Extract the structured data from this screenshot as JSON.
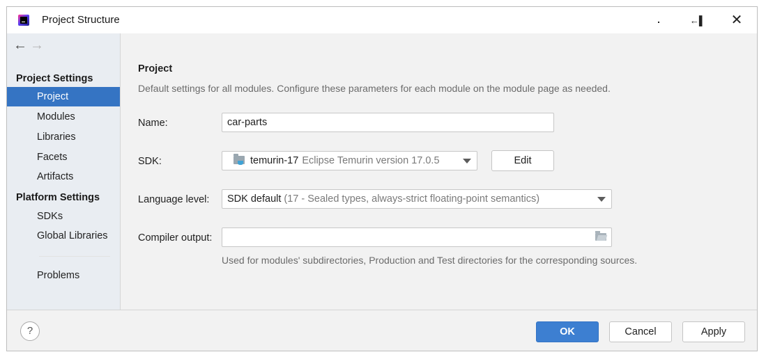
{
  "window": {
    "title": "Project Structure"
  },
  "sidebar": {
    "groups": [
      {
        "label": "Project Settings"
      },
      {
        "label": "Platform Settings"
      }
    ],
    "items": [
      {
        "label": "Project",
        "active": true
      },
      {
        "label": "Modules"
      },
      {
        "label": "Libraries"
      },
      {
        "label": "Facets"
      },
      {
        "label": "Artifacts"
      },
      {
        "label": "SDKs"
      },
      {
        "label": "Global Libraries"
      },
      {
        "label": "Problems"
      }
    ]
  },
  "main": {
    "title": "Project",
    "description": "Default settings for all modules. Configure these parameters for each module on the module page as needed.",
    "name": {
      "label": "Name:",
      "value": "car-parts"
    },
    "sdk": {
      "label": "SDK:",
      "name": "temurin-17",
      "version": "Eclipse Temurin version 17.0.5",
      "edit_label": "Edit"
    },
    "language_level": {
      "label": "Language level:",
      "value": "SDK default",
      "detail": "(17 - Sealed types, always-strict floating-point semantics)"
    },
    "compiler_output": {
      "label": "Compiler output:",
      "value": "",
      "hint": "Used for modules' subdirectories, Production and Test directories for the corresponding sources."
    }
  },
  "footer": {
    "help": "?",
    "ok": "OK",
    "cancel": "Cancel",
    "apply": "Apply"
  },
  "colors": {
    "accent": "#3574c3",
    "ok_button": "#3d7fd1",
    "sidebar_bg": "#e9edf2",
    "panel_bg": "#f2f2f2"
  }
}
